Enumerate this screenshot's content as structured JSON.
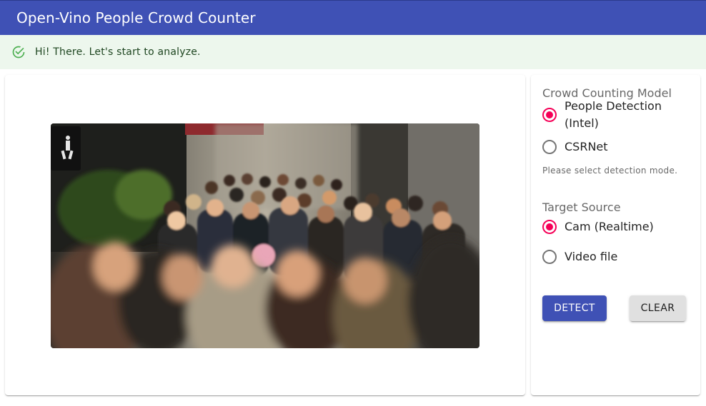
{
  "app": {
    "title": "Open-Vino People Crowd Counter"
  },
  "alert": {
    "icon": "check-circle-icon",
    "message": "Hi! There. Let's start to analyze."
  },
  "preview": {
    "description_icon": "crowd-photo"
  },
  "model": {
    "label": "Crowd Counting Model",
    "options": [
      {
        "label": "People Detection (Intel)",
        "selected": true
      },
      {
        "label": "CSRNet",
        "selected": false
      }
    ],
    "helper": "Please select detection mode."
  },
  "source": {
    "label": "Target Source",
    "options": [
      {
        "label": "Cam (Realtime)",
        "selected": true
      },
      {
        "label": "Video file",
        "selected": false
      }
    ]
  },
  "actions": {
    "detect_label": "DETECT",
    "clear_label": "CLEAR"
  },
  "colors": {
    "primary": "#3f51b5",
    "secondary": "#f50057",
    "success_bg": "#edf7ed",
    "success_icon": "#4caf50"
  }
}
